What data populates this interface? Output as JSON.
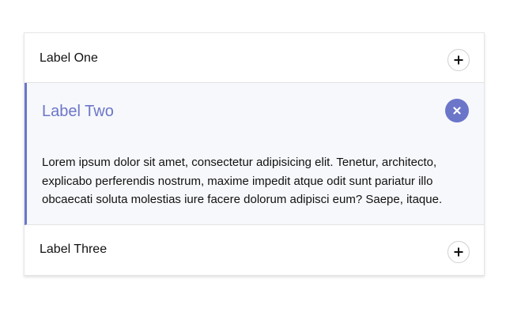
{
  "accordion": {
    "items": [
      {
        "label": "Label One",
        "expanded": false,
        "toggle_icon": "plus-icon"
      },
      {
        "label": "Label Two",
        "expanded": true,
        "toggle_icon": "close-icon",
        "content": "Lorem ipsum dolor sit amet, consectetur adipisicing elit. Tenetur, architecto, explicabo perferendis nostrum, maxime impedit atque odit sunt pariatur illo obcaecati soluta molestias iure facere dolorum adipisci eum? Saepe, itaque."
      },
      {
        "label": "Label Three",
        "expanded": false,
        "toggle_icon": "plus-icon"
      }
    ]
  },
  "colors": {
    "accent": "#6b76c9",
    "expanded_background": "#f7f8fb",
    "text": "#111111",
    "border": "#e3e3e3"
  }
}
